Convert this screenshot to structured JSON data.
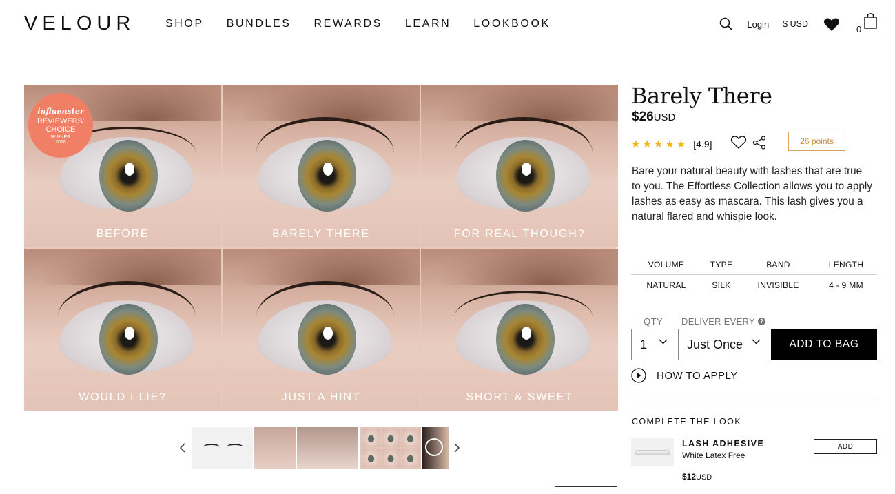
{
  "header": {
    "logo": "VELOUR",
    "nav": [
      "SHOP",
      "BUNDLES",
      "REWARDS",
      "LEARN",
      "LOOKBOOK"
    ],
    "login": "Login",
    "currency": "$ USD",
    "cart_count": "0",
    "icons": [
      "search-icon",
      "heart-icon",
      "shopping-bag-icon"
    ]
  },
  "gallery": {
    "badge": {
      "brand": "influenster",
      "line1": "REVIEWERS'",
      "line2": "CHOICE",
      "line3": "WINNER",
      "year": "2018"
    },
    "labels": [
      "BEFORE",
      "BARELY THERE",
      "FOR REAL THOUGH?",
      "WOULD I LIE?",
      "JUST A HINT",
      "SHORT & SWEET"
    ]
  },
  "product": {
    "title": "Barely There",
    "price": "$26",
    "price_currency": "USD",
    "stars": "★★★★★",
    "rating": "[4.9]",
    "points": "26 points",
    "description": "Bare your natural beauty with lashes that are true to you. The Effortless Collection allows you to apply lashes as easy as mascara. This lash gives you a natural flared and whispie look.",
    "specs": {
      "headers": [
        "VOLUME",
        "TYPE",
        "BAND",
        "LENGTH"
      ],
      "values": [
        "NATURAL",
        "SILK",
        "INVISIBLE",
        "4 - 9 MM"
      ]
    },
    "qty_label": "QTY",
    "qty_value": "1",
    "deliver_label": "DELIVER EVERY",
    "deliver_value": "Just Once",
    "add_to_bag": "ADD TO BAG",
    "how_to_apply": "HOW TO APPLY"
  },
  "complete_look": {
    "heading": "COMPLETE THE LOOK",
    "item_name": "LASH ADHESIVE",
    "item_sub": "White Latex Free",
    "item_price": "$12",
    "item_currency": "USD",
    "add": "ADD"
  }
}
